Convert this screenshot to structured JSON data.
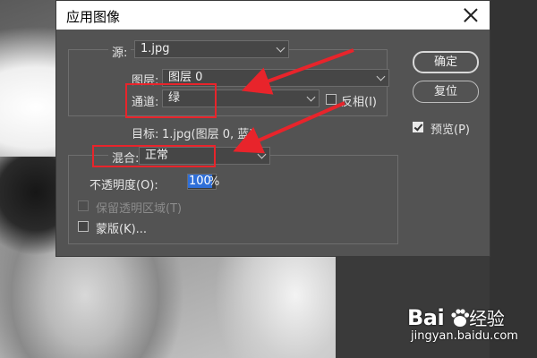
{
  "dialog": {
    "title": "应用图像",
    "source": {
      "label": "源:",
      "value": "1.jpg"
    },
    "layer": {
      "label": "图层:",
      "value": "图层 0"
    },
    "channel": {
      "label": "通道:",
      "value": "绿",
      "invert_label": "反相(I)",
      "invert_checked": false
    },
    "target": {
      "label": "目标:",
      "value": "1.jpg(图层 0, 蓝)"
    },
    "blend": {
      "label": "混合:",
      "value": "正常"
    },
    "opacity": {
      "label": "不透明度(O):",
      "value": "100",
      "unit": "%"
    },
    "preserve_transparency": {
      "label": "保留透明区域(T)",
      "enabled": false
    },
    "mask": {
      "label": "蒙版(K)..."
    },
    "buttons": {
      "ok": "确定",
      "reset": "复位"
    },
    "preview": {
      "label": "预览(P)",
      "checked": true
    }
  },
  "annotations": {
    "color": "#e8242b"
  },
  "watermark": {
    "logo_left": "Bai",
    "logo_right": "经验",
    "url": "jingyan.baidu.com"
  }
}
